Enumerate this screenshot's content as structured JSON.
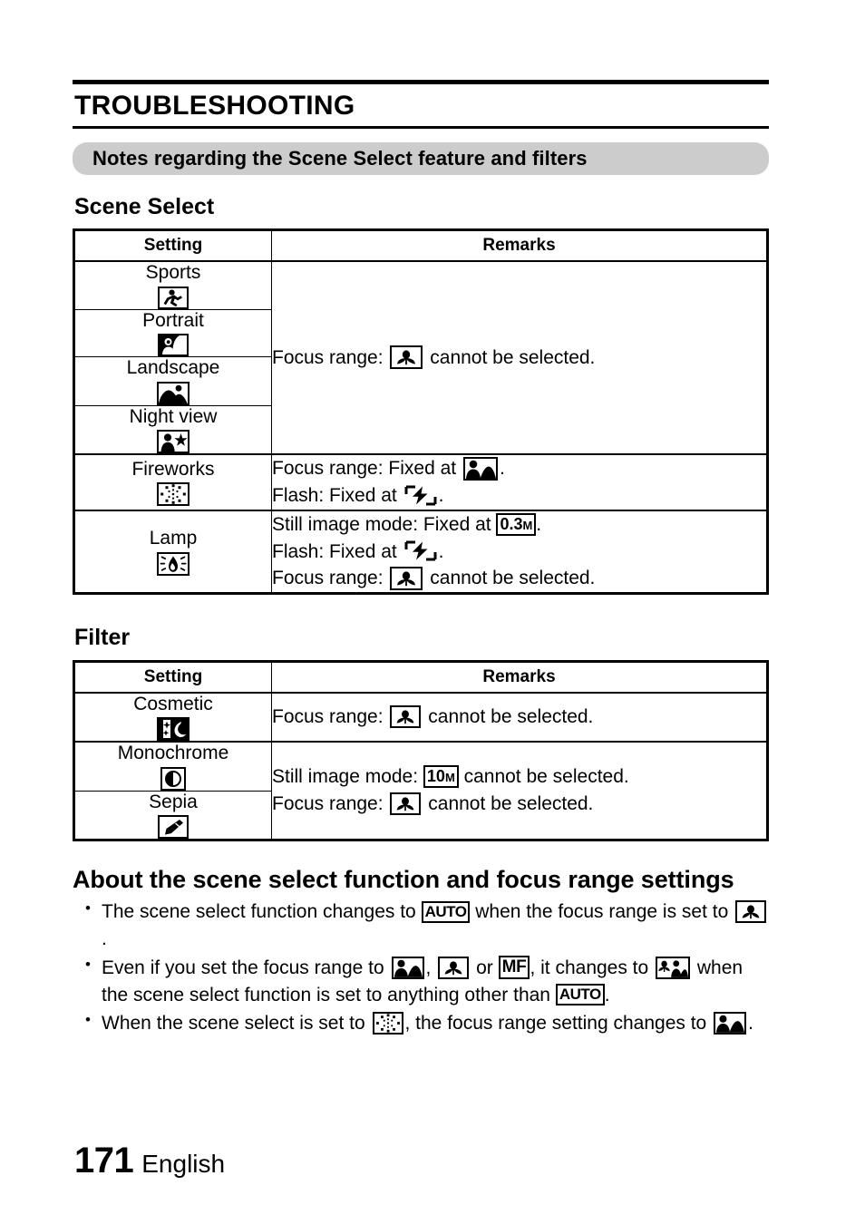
{
  "chapter": {
    "title": "TROUBLESHOOTING"
  },
  "banner": {
    "text": "Notes regarding the Scene Select feature and filters"
  },
  "scene_select": {
    "heading": "Scene Select",
    "columns": {
      "setting": "Setting",
      "remarks": "Remarks"
    },
    "rows": [
      {
        "label": "Sports",
        "icon": "sports-icon"
      },
      {
        "label": "Portrait",
        "icon": "portrait-icon"
      },
      {
        "label": "Landscape",
        "icon": "landscape-icon"
      },
      {
        "label": "Night view",
        "icon": "night-view-icon"
      },
      {
        "label": "Fireworks",
        "icon": "fireworks-icon"
      },
      {
        "label": "Lamp",
        "icon": "lamp-icon"
      }
    ],
    "remark_group1": {
      "prefix": "Focus range:",
      "icon": "macro-icon",
      "suffix": "cannot be selected."
    },
    "remark_fireworks": {
      "line1_prefix": "Focus range: Fixed at",
      "line1_icon": "portrait-landscape-icon",
      "line1_suffix": ".",
      "line2_prefix": "Flash: Fixed at",
      "line2_icon": "flash-off-icon",
      "line2_suffix": "."
    },
    "remark_lamp": {
      "line1_prefix": "Still image mode: Fixed at",
      "line1_icon": "0.3M",
      "line1_suffix": ".",
      "line2_prefix": "Flash: Fixed at",
      "line2_icon": "flash-off-icon",
      "line2_suffix": ".",
      "line3_prefix": "Focus range:",
      "line3_icon": "macro-icon",
      "line3_suffix": "cannot be selected."
    }
  },
  "filter": {
    "heading": "Filter",
    "columns": {
      "setting": "Setting",
      "remarks": "Remarks"
    },
    "rows": [
      {
        "label": "Cosmetic",
        "icon": "cosmetic-icon"
      },
      {
        "label": "Monochrome",
        "icon": "monochrome-icon"
      },
      {
        "label": "Sepia",
        "icon": "sepia-icon"
      }
    ],
    "remark_cosmetic": {
      "prefix": "Focus range:",
      "icon": "macro-icon",
      "suffix": "cannot be selected."
    },
    "remark_mono_sepia": {
      "line1_prefix": "Still image mode:",
      "line1_icon": "10M",
      "line1_suffix": "cannot be selected.",
      "line2_prefix": "Focus range:",
      "line2_icon": "macro-icon",
      "line2_suffix": "cannot be selected."
    }
  },
  "about": {
    "heading": "About the scene select function and focus range settings",
    "bullets": [
      {
        "part1": "The scene select function changes to",
        "icon1": "AUTO",
        "part2": "when the focus range is set to",
        "icon2": "macro-icon",
        "part3": "."
      },
      {
        "part1": "Even if you set the focus range to",
        "icon1": "portrait-landscape-icon",
        "part2": ",",
        "icon2": "macro-icon",
        "part3": "or",
        "icon3": "MF",
        "part4": ", it changes to",
        "icon4": "macro-landscape-icon",
        "part5": "when the scene select function is set to anything other than",
        "icon5": "AUTO",
        "part6": "."
      },
      {
        "part1": "When the scene select is set to",
        "icon1": "fireworks-icon",
        "part2": ", the focus range setting changes to",
        "icon2": "portrait-landscape-icon",
        "part3": "."
      }
    ]
  },
  "footer": {
    "page_number": "171",
    "language": "English"
  }
}
